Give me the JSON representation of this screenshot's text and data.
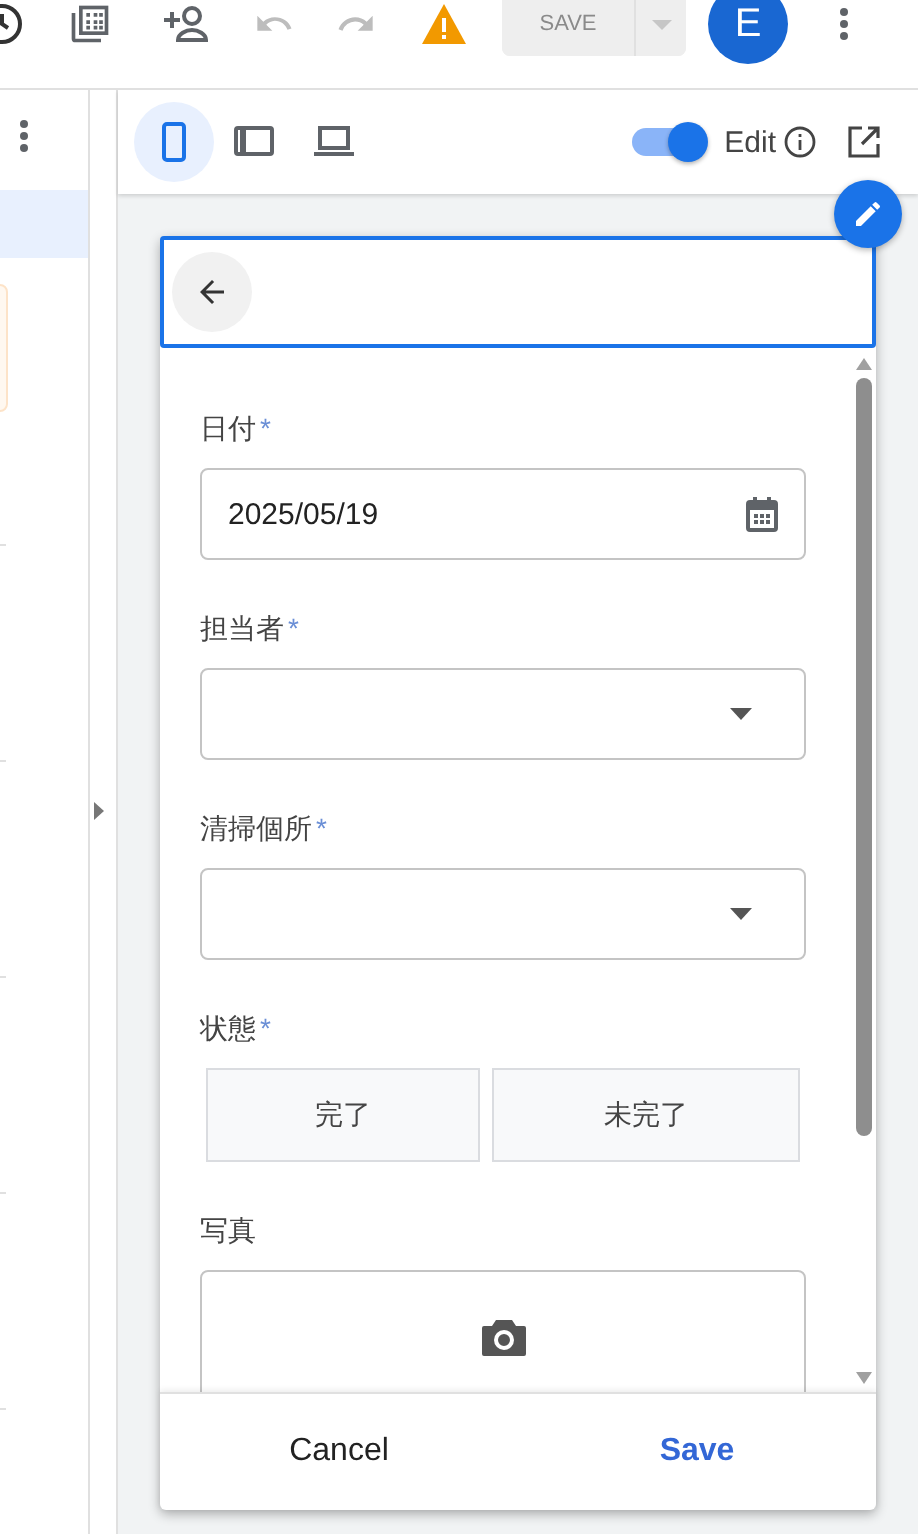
{
  "top_bar": {
    "save_button": {
      "label": "SAVE",
      "disabled": true
    },
    "avatar": {
      "initial": "E"
    }
  },
  "preview_toolbar": {
    "devices": [
      {
        "kind": "phone",
        "selected": true
      },
      {
        "kind": "tablet",
        "selected": false
      },
      {
        "kind": "laptop",
        "selected": false
      }
    ],
    "edit_toggle": {
      "label": "Edit",
      "on": true
    }
  },
  "form": {
    "fields": [
      {
        "kind": "date",
        "label": "日付",
        "required_mark": "*",
        "value": "2025/05/19"
      },
      {
        "kind": "select",
        "label": "担当者",
        "required_mark": "*"
      },
      {
        "kind": "select",
        "label": "清掃個所",
        "required_mark": "*"
      },
      {
        "kind": "choice",
        "label": "状態",
        "required_mark": "*",
        "options": [
          {
            "label": "完了",
            "selected": false
          },
          {
            "label": "未完了",
            "selected": false
          }
        ]
      },
      {
        "kind": "photo",
        "label": "写真"
      }
    ]
  },
  "footer": {
    "buttons": [
      {
        "kind": "cancel",
        "label": "Cancel"
      },
      {
        "kind": "save",
        "label": "Save"
      }
    ]
  }
}
